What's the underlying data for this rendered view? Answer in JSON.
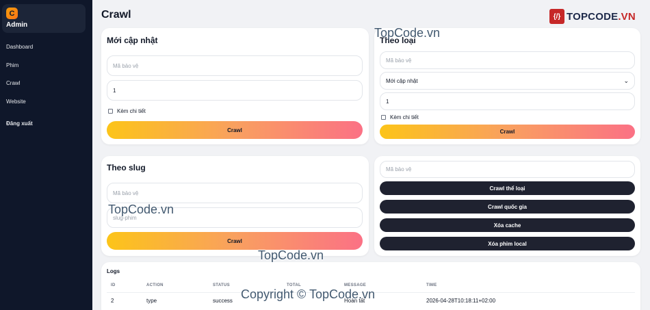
{
  "sidebar": {
    "logo_letter": "C",
    "brand": "Admin",
    "items": [
      {
        "label": "Dashboard"
      },
      {
        "label": "Phim"
      },
      {
        "label": "Crawl"
      },
      {
        "label": "Website"
      }
    ],
    "logout": "Đăng xuất"
  },
  "header": {
    "title": "Crawl",
    "logo_mark": "{/}",
    "logo_text_a": "TOPCODE",
    "logo_text_b": ".VN"
  },
  "latest": {
    "title": "Mới cập nhật",
    "key_placeholder": "Mã bảo vệ",
    "pages_value": "1",
    "detail_label": "Kèm chi tiết",
    "crawl_label": "Crawl"
  },
  "by_category": {
    "title": "Theo loại",
    "key_placeholder": "Mã bảo vệ",
    "type_selected": "Mới cập nhật",
    "pages_value": "1",
    "detail_label": "Kèm chi tiết",
    "crawl_label": "Crawl"
  },
  "by_slug": {
    "title": "Theo slug",
    "key_placeholder": "Mã bảo vệ",
    "slug_placeholder": "slug-phim",
    "crawl_label": "Crawl"
  },
  "tools": {
    "key_placeholder": "Mã bảo vệ",
    "buttons": [
      "Crawl thể loại",
      "Crawl quốc gia",
      "Xóa cache",
      "Xóa phim local"
    ]
  },
  "logs": {
    "title": "Logs",
    "columns": [
      "ID",
      "ACTION",
      "STATUS",
      "TOTAL",
      "MESSAGE",
      "TIME"
    ],
    "rows": [
      {
        "id": "2",
        "action": "type",
        "status": "success",
        "total": "",
        "message": "Hoàn tất",
        "time": "2026-04-28T10:18:11+02:00"
      }
    ]
  },
  "watermarks": {
    "site": "TopCode.vn",
    "copyright": "Copyright © TopCode.vn"
  },
  "colors": {
    "sidebar_bg": "#0f172a",
    "accent_gradient_start": "#fcc419",
    "accent_gradient_end": "#fb7185",
    "dark_button": "#1f2230"
  }
}
